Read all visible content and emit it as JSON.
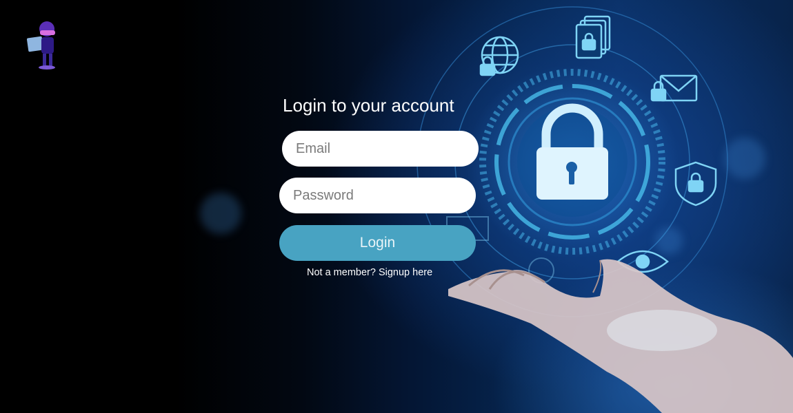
{
  "logo": {
    "icon": "hacker-avatar-icon"
  },
  "form": {
    "title": "Login to your account",
    "email_placeholder": "Email",
    "password_placeholder": "Password",
    "login_label": "Login",
    "signup_text": "Not a member? Signup here"
  },
  "background": {
    "icons": [
      "globe-lock-icon",
      "documents-lock-icon",
      "envelope-lock-icon",
      "shield-lock-icon",
      "padlock-icon",
      "eye-icon",
      "hand-icon"
    ]
  },
  "colors": {
    "login_button": "#48a3c2",
    "accent_glow": "#4fc3f0"
  }
}
